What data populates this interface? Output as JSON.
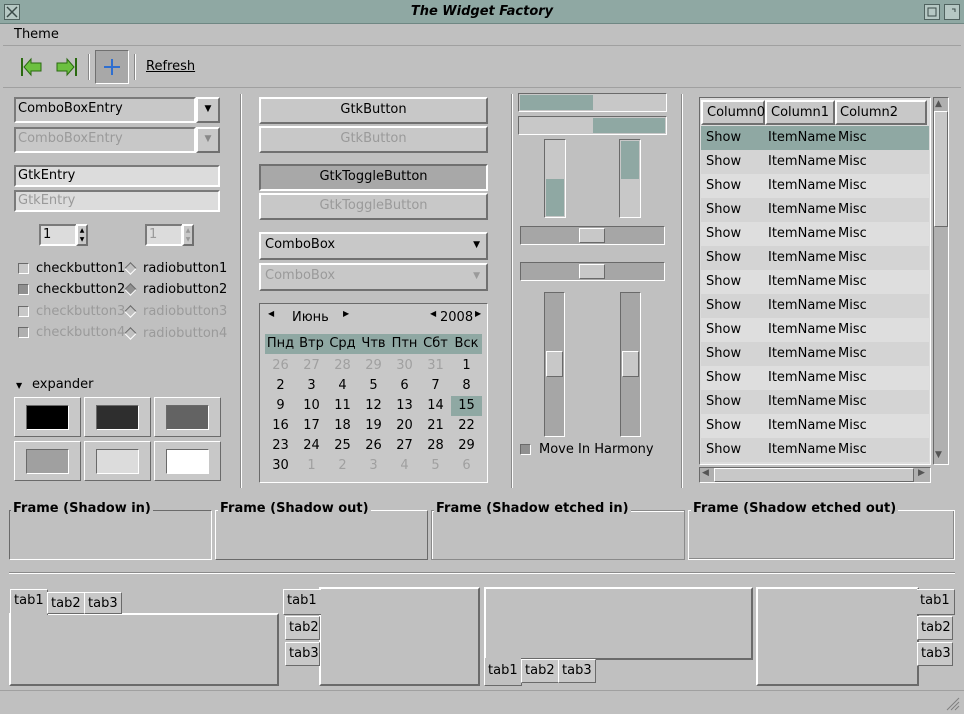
{
  "window": {
    "title": "The Widget Factory"
  },
  "menu": {
    "theme": "Theme"
  },
  "toolbar": {
    "refresh": "Refresh"
  },
  "combo_entry": {
    "value": "ComboBoxEntry",
    "disabled_value": "ComboBoxEntry"
  },
  "entry": {
    "value": "GtkEntry",
    "disabled_value": "GtkEntry"
  },
  "spin": {
    "value": "1",
    "disabled_value": "1"
  },
  "checks": [
    "checkbutton1",
    "checkbutton2",
    "checkbutton3",
    "checkbutton4"
  ],
  "radios": [
    "radiobutton1",
    "radiobutton2",
    "radiobutton3",
    "radiobutton4"
  ],
  "expander": {
    "label": "expander"
  },
  "swatch_colors": [
    "#000000",
    "#2e2e2e",
    "#636363",
    "#a0a0a0",
    "#dcdcdc",
    "#ffffff"
  ],
  "buttons": {
    "button": "GtkButton",
    "button_dis": "GtkButton",
    "toggle": "GtkToggleButton",
    "toggle_dis": "GtkToggleButton"
  },
  "combobox": {
    "value": "ComboBox",
    "disabled_value": "ComboBox"
  },
  "calendar": {
    "month": "Июнь",
    "year": "2008",
    "weekdays": [
      "Пнд",
      "Втр",
      "Срд",
      "Чтв",
      "Птн",
      "Сбт",
      "Вск"
    ],
    "prev_days": [
      "26",
      "27",
      "28",
      "29",
      "30",
      "31"
    ],
    "days": [
      "1",
      "2",
      "3",
      "4",
      "5",
      "6",
      "7",
      "8",
      "9",
      "10",
      "11",
      "12",
      "13",
      "14",
      "15",
      "16",
      "17",
      "18",
      "19",
      "20",
      "21",
      "22",
      "23",
      "24",
      "25",
      "26",
      "27",
      "28",
      "29",
      "30"
    ],
    "next_days": [
      "1",
      "2",
      "3",
      "4",
      "5",
      "6"
    ],
    "selected": "15"
  },
  "progress": {
    "h1": 0.5,
    "h2": 0.5,
    "v1": 0.5,
    "v2": 0.5
  },
  "harmony": {
    "label": "Move In Harmony"
  },
  "tree": {
    "columns": [
      "Column0",
      "Column1",
      "Column2"
    ],
    "rows": [
      [
        "Show",
        "ItemName",
        "Misc"
      ],
      [
        "Show",
        "ItemName",
        "Misc"
      ],
      [
        "Show",
        "ItemName",
        "Misc"
      ],
      [
        "Show",
        "ItemName",
        "Misc"
      ],
      [
        "Show",
        "ItemName",
        "Misc"
      ],
      [
        "Show",
        "ItemName",
        "Misc"
      ],
      [
        "Show",
        "ItemName",
        "Misc"
      ],
      [
        "Show",
        "ItemName",
        "Misc"
      ],
      [
        "Show",
        "ItemName",
        "Misc"
      ],
      [
        "Show",
        "ItemName",
        "Misc"
      ],
      [
        "Show",
        "ItemName",
        "Misc"
      ],
      [
        "Show",
        "ItemName",
        "Misc"
      ],
      [
        "Show",
        "ItemName",
        "Misc"
      ],
      [
        "Show",
        "ItemName",
        "Misc"
      ]
    ],
    "selected_color": "#8fa8a3"
  },
  "frames": [
    "Frame (Shadow in)",
    "Frame (Shadow out)",
    "Frame (Shadow etched in)",
    "Frame (Shadow etched out)"
  ],
  "tabs": [
    "tab1",
    "tab2",
    "tab3"
  ]
}
